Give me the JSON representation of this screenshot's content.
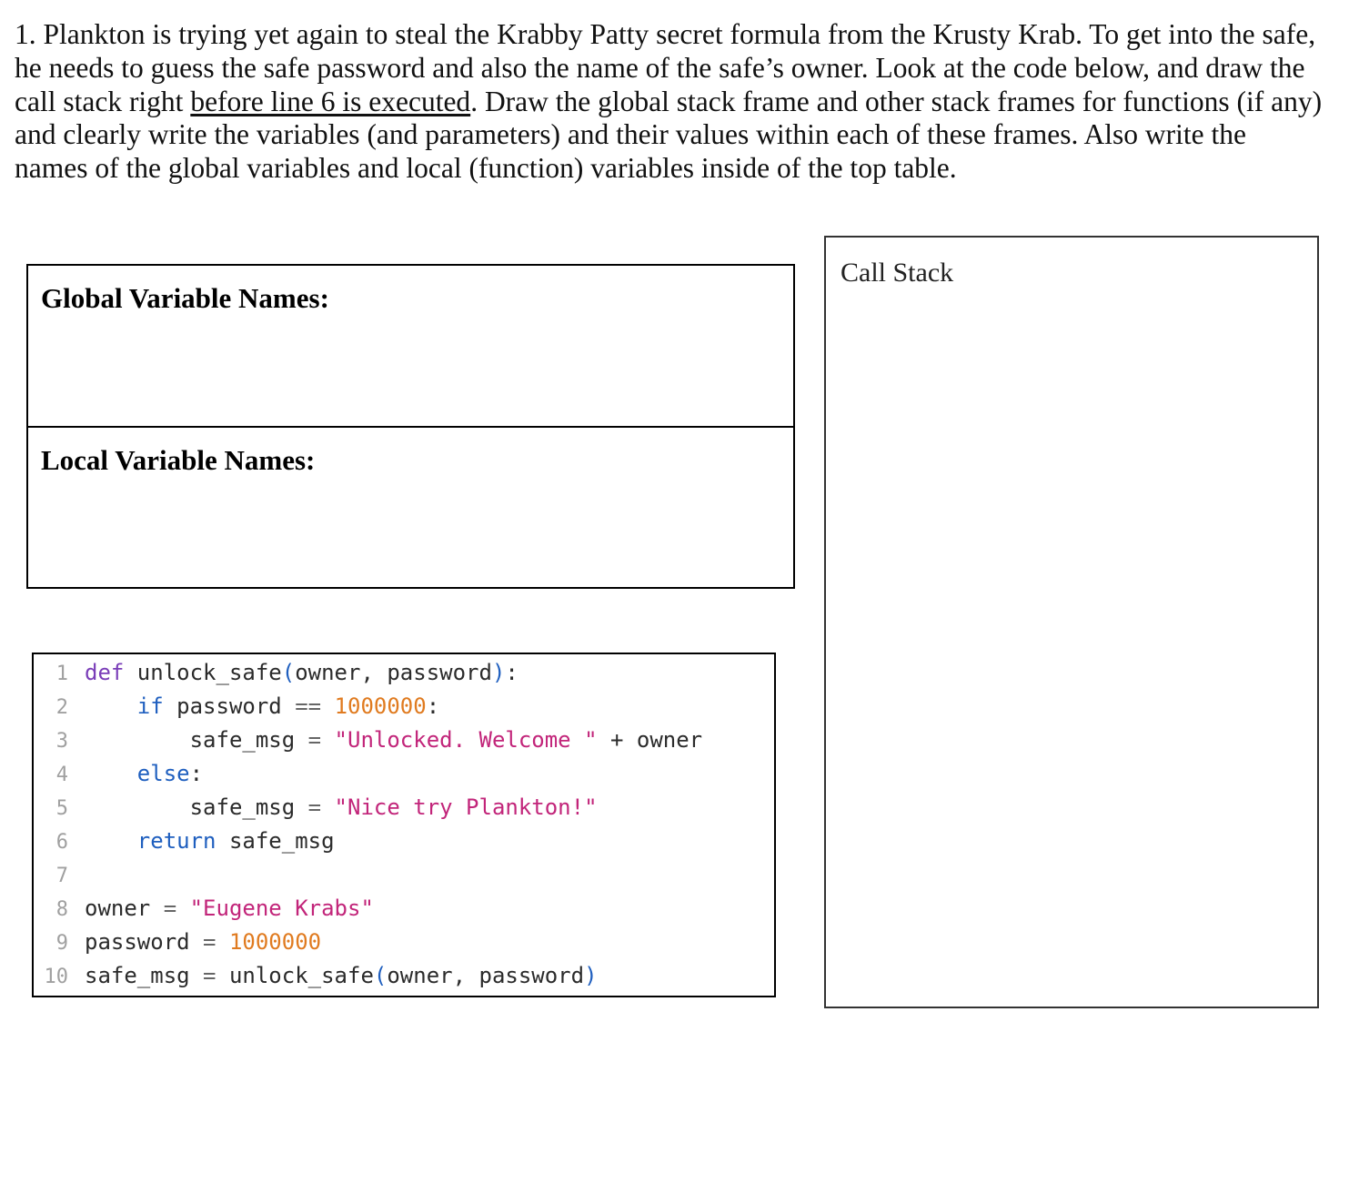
{
  "question": {
    "number": "1.",
    "text_before": "Plankton is trying yet again to steal the Krabby Patty secret formula from the Krusty Krab. To get into the safe, he needs to guess the safe password and also the name of the safe’s owner.  Look at the code below, and draw the call stack right",
    "underlined": "before line 6 is executed",
    "text_after": ". Draw the global stack frame and other stack frames for functions (if any) and clearly write the variables (and parameters) and their values within each of these frames. Also write the names of the global variables and local (function) variables inside of the top table."
  },
  "vars_table": {
    "global_label": "Global Variable Names:",
    "local_label": "Local Variable Names:"
  },
  "callstack": {
    "title": "Call Stack"
  },
  "code": {
    "lines": [
      {
        "n": "1",
        "tokens": [
          {
            "t": "def",
            "c": "kw"
          },
          {
            "t": " unlock_safe",
            "c": ""
          },
          {
            "t": "(",
            "c": "punc"
          },
          {
            "t": "owner, password",
            "c": ""
          },
          {
            "t": ")",
            "c": "punc"
          },
          {
            "t": ":",
            "c": ""
          }
        ]
      },
      {
        "n": "2",
        "tokens": [
          {
            "t": "    ",
            "c": ""
          },
          {
            "t": "if",
            "c": "kw-blue"
          },
          {
            "t": " password ",
            "c": ""
          },
          {
            "t": "==",
            "c": "op"
          },
          {
            "t": " ",
            "c": ""
          },
          {
            "t": "1000000",
            "c": "num"
          },
          {
            "t": ":",
            "c": ""
          }
        ]
      },
      {
        "n": "3",
        "tokens": [
          {
            "t": "        safe_msg ",
            "c": ""
          },
          {
            "t": "=",
            "c": "op"
          },
          {
            "t": " ",
            "c": ""
          },
          {
            "t": "\"Unlocked. Welcome \"",
            "c": "str"
          },
          {
            "t": " + owner",
            "c": ""
          }
        ]
      },
      {
        "n": "4",
        "tokens": [
          {
            "t": "    ",
            "c": ""
          },
          {
            "t": "else",
            "c": "kw-blue"
          },
          {
            "t": ":",
            "c": ""
          }
        ]
      },
      {
        "n": "5",
        "tokens": [
          {
            "t": "        safe_msg ",
            "c": ""
          },
          {
            "t": "=",
            "c": "op"
          },
          {
            "t": " ",
            "c": ""
          },
          {
            "t": "\"Nice try Plankton!\"",
            "c": "str"
          }
        ]
      },
      {
        "n": "6",
        "tokens": [
          {
            "t": "    ",
            "c": ""
          },
          {
            "t": "return",
            "c": "kw-blue"
          },
          {
            "t": " safe_msg",
            "c": ""
          }
        ]
      },
      {
        "n": "7",
        "tokens": []
      },
      {
        "n": "8",
        "tokens": [
          {
            "t": "owner ",
            "c": ""
          },
          {
            "t": "=",
            "c": "op"
          },
          {
            "t": " ",
            "c": ""
          },
          {
            "t": "\"Eugene Krabs\"",
            "c": "str"
          }
        ]
      },
      {
        "n": "9",
        "tokens": [
          {
            "t": "password ",
            "c": ""
          },
          {
            "t": "=",
            "c": "op"
          },
          {
            "t": " ",
            "c": ""
          },
          {
            "t": "1000000",
            "c": "num"
          }
        ]
      },
      {
        "n": "10",
        "tokens": [
          {
            "t": "safe_msg ",
            "c": ""
          },
          {
            "t": "=",
            "c": "op"
          },
          {
            "t": " unlock_safe",
            "c": ""
          },
          {
            "t": "(",
            "c": "punc"
          },
          {
            "t": "owner, password",
            "c": ""
          },
          {
            "t": ")",
            "c": "punc"
          }
        ]
      }
    ]
  }
}
